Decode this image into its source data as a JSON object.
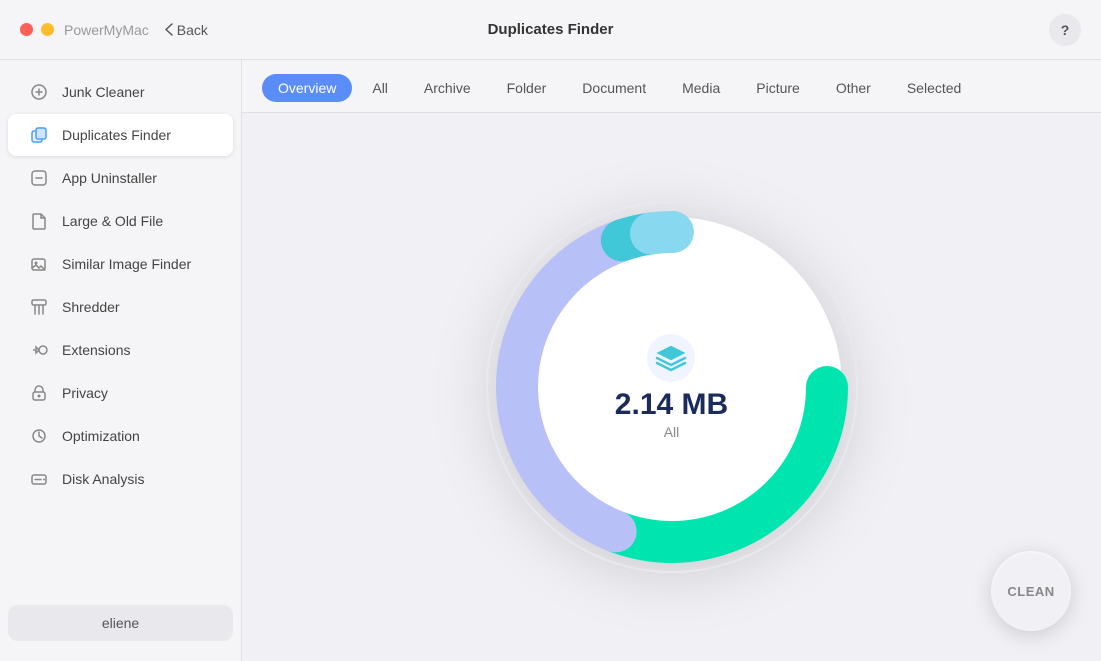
{
  "titlebar": {
    "app_name": "PowerMyMac",
    "back_label": "Back",
    "window_title": "Duplicates Finder",
    "help_label": "?"
  },
  "sidebar": {
    "items": [
      {
        "id": "junk-cleaner",
        "label": "Junk Cleaner",
        "icon": "⚙️",
        "active": false
      },
      {
        "id": "duplicates-finder",
        "label": "Duplicates Finder",
        "icon": "📋",
        "active": true
      },
      {
        "id": "app-uninstaller",
        "label": "App Uninstaller",
        "icon": "🗑️",
        "active": false
      },
      {
        "id": "large-old-file",
        "label": "Large & Old File",
        "icon": "📁",
        "active": false
      },
      {
        "id": "similar-image-finder",
        "label": "Similar Image Finder",
        "icon": "🖼️",
        "active": false
      },
      {
        "id": "shredder",
        "label": "Shredder",
        "icon": "📄",
        "active": false
      },
      {
        "id": "extensions",
        "label": "Extensions",
        "icon": "🔧",
        "active": false
      },
      {
        "id": "privacy",
        "label": "Privacy",
        "icon": "🔒",
        "active": false
      },
      {
        "id": "optimization",
        "label": "Optimization",
        "icon": "⚡",
        "active": false
      },
      {
        "id": "disk-analysis",
        "label": "Disk Analysis",
        "icon": "💽",
        "active": false
      }
    ],
    "user": "eliene"
  },
  "tabs": [
    {
      "id": "overview",
      "label": "Overview",
      "active": true
    },
    {
      "id": "all",
      "label": "All",
      "active": false
    },
    {
      "id": "archive",
      "label": "Archive",
      "active": false
    },
    {
      "id": "folder",
      "label": "Folder",
      "active": false
    },
    {
      "id": "document",
      "label": "Document",
      "active": false
    },
    {
      "id": "media",
      "label": "Media",
      "active": false
    },
    {
      "id": "picture",
      "label": "Picture",
      "active": false
    },
    {
      "id": "other",
      "label": "Other",
      "active": false
    },
    {
      "id": "selected",
      "label": "Selected",
      "active": false
    }
  ],
  "chart": {
    "size_value": "2.14 MB",
    "label": "All",
    "colors": {
      "green": "#00e5b0",
      "purple": "#b0b8f8",
      "teal": "#40c8d8",
      "light_blue": "#88d8f0"
    }
  },
  "clean_button": {
    "label": "CLEAN"
  }
}
